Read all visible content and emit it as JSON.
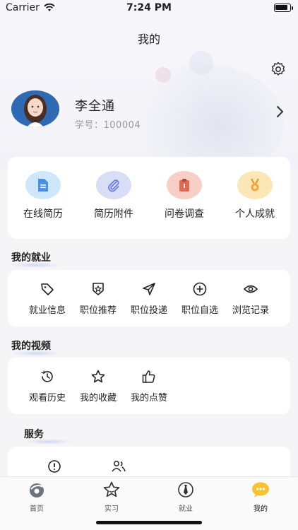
{
  "status": {
    "carrier": "Carrier",
    "time": "7:24 PM"
  },
  "nav": {
    "title": "我的"
  },
  "profile": {
    "name": "李全通",
    "student_no": "学号：100004"
  },
  "quick_actions": [
    {
      "label": "在线简历",
      "icon": "document-icon",
      "color": "#cfe7fb"
    },
    {
      "label": "简历附件",
      "icon": "paperclip-icon",
      "color": "#d9def7"
    },
    {
      "label": "问卷调查",
      "icon": "clipboard-icon",
      "color": "#f6cfc7"
    },
    {
      "label": "个人成就",
      "icon": "medal-icon",
      "color": "#fbe7b5"
    }
  ],
  "employment": {
    "title": "我的就业",
    "items": [
      {
        "label": "就业信息",
        "icon": "tag-icon"
      },
      {
        "label": "职位推荐",
        "icon": "badge-star-icon"
      },
      {
        "label": "职位投递",
        "icon": "send-icon"
      },
      {
        "label": "职位自选",
        "icon": "plus-circle-icon"
      },
      {
        "label": "浏览记录",
        "icon": "eye-icon"
      }
    ]
  },
  "videos": {
    "title": "我的视频",
    "items": [
      {
        "label": "观看历史",
        "icon": "history-icon"
      },
      {
        "label": "我的收藏",
        "icon": "star-icon"
      },
      {
        "label": "我的点赞",
        "icon": "thumbs-up-icon"
      }
    ]
  },
  "services": {
    "title": "服务",
    "icons": [
      "alert-circle-icon",
      "users-icon"
    ]
  },
  "tabbar": [
    {
      "label": "首页",
      "icon": "home-icon"
    },
    {
      "label": "实习",
      "icon": "star-tab-icon"
    },
    {
      "label": "就业",
      "icon": "tie-icon"
    },
    {
      "label": "我的",
      "icon": "chat-bubble-icon",
      "active": true
    }
  ]
}
